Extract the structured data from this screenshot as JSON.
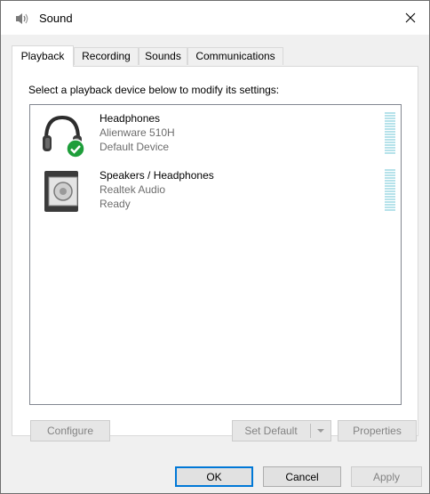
{
  "window": {
    "title": "Sound",
    "icon": "speaker-icon",
    "close_icon": "close-icon"
  },
  "tabs": [
    {
      "label": "Playback",
      "active": true
    },
    {
      "label": "Recording",
      "active": false
    },
    {
      "label": "Sounds",
      "active": false
    },
    {
      "label": "Communications",
      "active": false
    }
  ],
  "playback": {
    "instruction": "Select a playback device below to modify its settings:",
    "devices": [
      {
        "name": "Headphones",
        "model": "Alienware 510H",
        "status": "Default Device",
        "icon": "headphones-icon",
        "badge": "default-check-icon"
      },
      {
        "name": "Speakers / Headphones",
        "model": "Realtek Audio",
        "status": "Ready",
        "icon": "speaker-box-icon"
      }
    ],
    "buttons": {
      "configure": "Configure",
      "set_default": "Set Default",
      "properties": "Properties"
    }
  },
  "footer": {
    "ok": "OK",
    "cancel": "Cancel",
    "apply": "Apply"
  },
  "colors": {
    "accent": "#0078d7",
    "check_badge": "#1e9e3a",
    "meter": "#b6e2ea"
  }
}
